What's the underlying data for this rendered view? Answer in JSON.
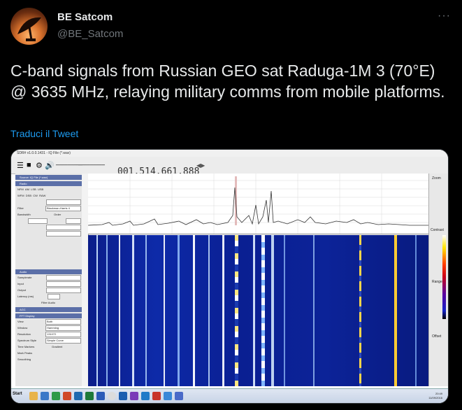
{
  "author": {
    "name": "BE Satcom",
    "handle": "@BE_Satcom"
  },
  "tweet": {
    "text": "C-band signals from Russian GEO sat Raduga-1M 3 (70°E) @ 3635 MHz, relaying military comms from mobile platforms.",
    "translate_label": "Traduci il Tweet",
    "more_label": "···"
  },
  "sdr": {
    "window_title": "SDR# v1.0.0.1431 - IQ File (*.wav)",
    "frequency": "001.514.661.888",
    "panel": {
      "source_header": "Source: IQ File (*.wav)",
      "radio_header": "Radio",
      "modes": [
        "NFM",
        "AM",
        "LSB",
        "USB",
        "WFM",
        "DSB",
        "CW",
        "RAW"
      ],
      "filter_label": "Filter",
      "filter_value": "Blackman-Harris 4",
      "bandwidth_label": "Bandwidth",
      "order_label": "Order",
      "audio_header": "Audio",
      "samplerate_label": "Samplerate",
      "input_label": "Input",
      "output_label": "Output",
      "latency_label": "Latency (ms)",
      "filter_audio_label": "Filter Audio",
      "agc_header": "AGC",
      "fft_header": "FFT Display",
      "view_label": "View",
      "view_value": "Both",
      "window_label": "Window",
      "window_value": "Hamming",
      "resolution_label": "Resolution",
      "resolution_value": "131072",
      "spectrum_style_label": "Spectrum Style",
      "spectrum_style_value": "Simple Curve",
      "time_markers_label": "Time Markers",
      "gradient_label": "Gradient",
      "mark_peaks_label": "Mark Peaks",
      "smoothing_label": "Smoothing"
    },
    "right_labels": [
      "Zoom",
      "Contrast",
      "Range",
      "Offset"
    ],
    "tray_time": "20:49",
    "tray_date": "11/09/2016",
    "start_label": "Start"
  }
}
